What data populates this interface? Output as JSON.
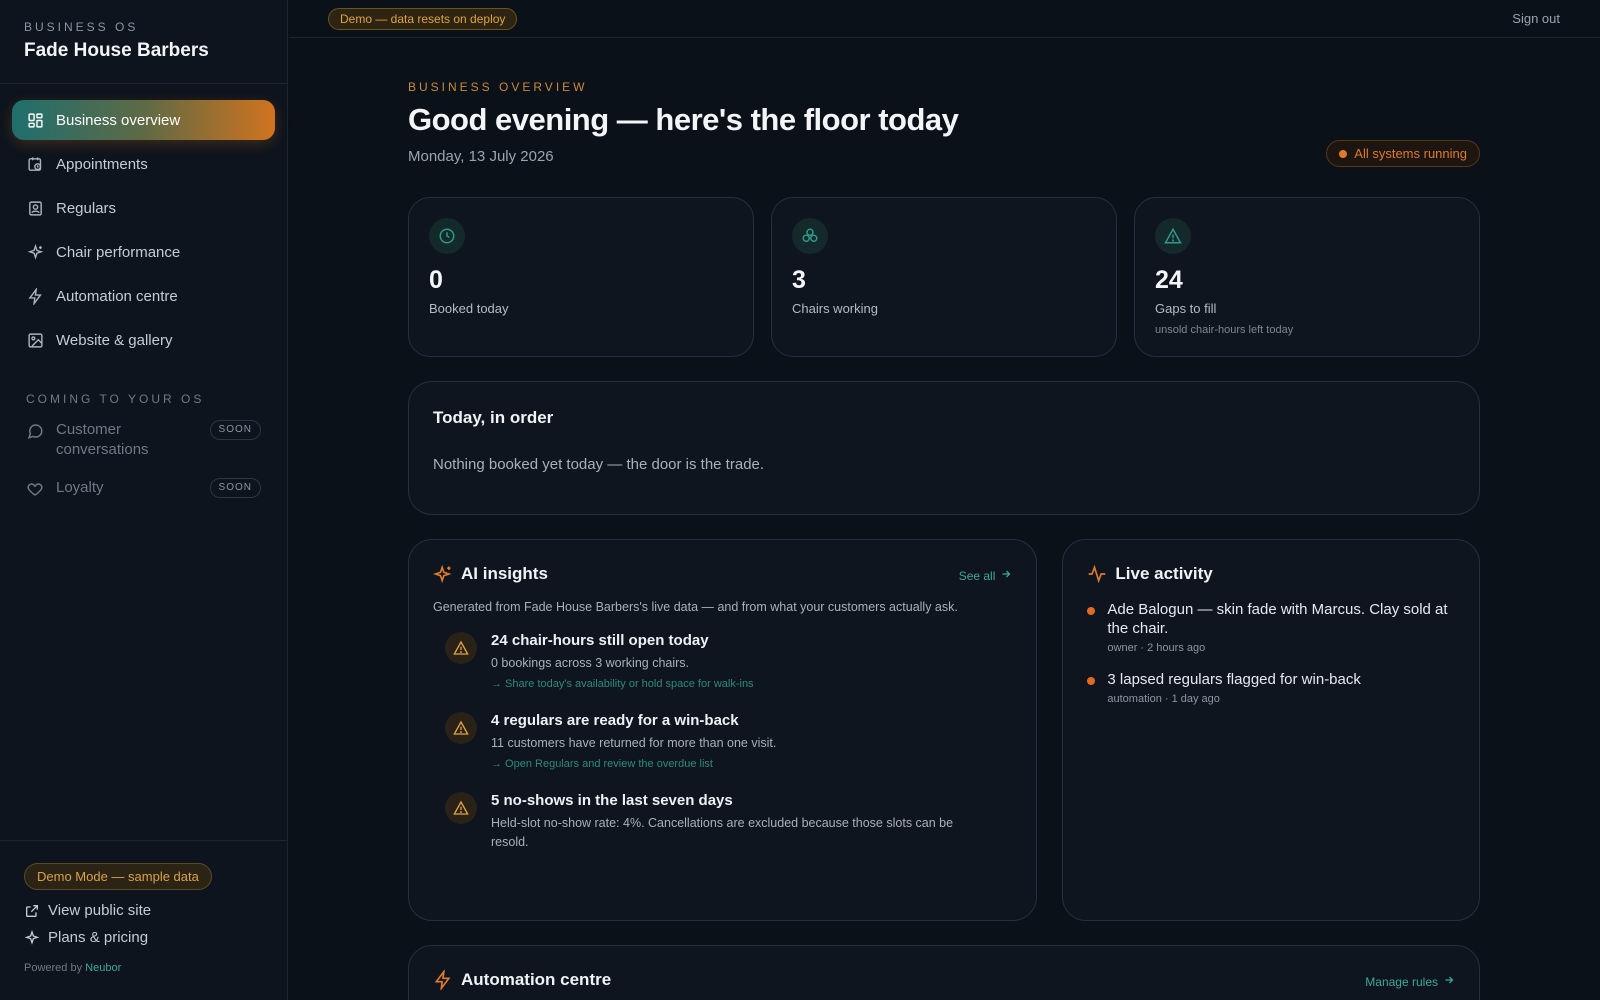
{
  "brand": {
    "eyebrow": "BUSINESS OS",
    "name": "Fade House Barbers"
  },
  "nav": {
    "items": [
      {
        "label": "Business overview",
        "icon": "grid-icon",
        "active": true
      },
      {
        "label": "Appointments",
        "icon": "calendar-clock-icon"
      },
      {
        "label": "Regulars",
        "icon": "contact-badge-icon"
      },
      {
        "label": "Chair performance",
        "icon": "sparkle-icon"
      },
      {
        "label": "Automation centre",
        "icon": "lightning-icon"
      },
      {
        "label": "Website & gallery",
        "icon": "image-icon"
      }
    ],
    "coming_label": "COMING TO YOUR OS",
    "coming": [
      {
        "label": "Customer conversations",
        "badge": "SOON",
        "icon": "chat-icon"
      },
      {
        "label": "Loyalty",
        "badge": "SOON",
        "icon": "heart-icon"
      }
    ]
  },
  "sidebar_footer": {
    "demo_mode": "Demo Mode — sample data",
    "view_public_site": "View public site",
    "plans_pricing": "Plans & pricing",
    "powered_prefix": "Powered by",
    "powered_brand": "Neubor"
  },
  "topbar": {
    "demo_banner": "Demo — data resets on deploy",
    "sign_out": "Sign out"
  },
  "header": {
    "eyebrow": "BUSINESS OVERVIEW",
    "title": "Good evening — here's the floor today",
    "date": "Monday, 13 July 2026",
    "status": "All systems running"
  },
  "stats": [
    {
      "value": "0",
      "label": "Booked today",
      "sub": "",
      "icon": "clock-icon"
    },
    {
      "value": "3",
      "label": "Chairs working",
      "sub": "",
      "icon": "chairs-icon"
    },
    {
      "value": "24",
      "label": "Gaps to fill",
      "sub": "unsold chair-hours left today",
      "icon": "warning-icon"
    }
  ],
  "today": {
    "title": "Today, in order",
    "empty": "Nothing booked yet today — the door is the trade."
  },
  "ai": {
    "title": "AI insights",
    "see_all": "See all",
    "subtitle": "Generated from Fade House Barbers's live data — and from what your customers actually ask.",
    "insights": [
      {
        "title": "24 chair-hours still open today",
        "desc": "0 bookings across 3 working chairs.",
        "action": "→ Share today's availability or hold space for walk-ins"
      },
      {
        "title": "4 regulars are ready for a win-back",
        "desc": "11 customers have returned for more than one visit.",
        "action": "→ Open Regulars and review the overdue list"
      },
      {
        "title": "5 no-shows in the last seven days",
        "desc": "Held-slot no-show rate: 4%. Cancellations are excluded because those slots can be resold.",
        "action": ""
      }
    ]
  },
  "live": {
    "title": "Live activity",
    "items": [
      {
        "text": "Ade Balogun — skin fade with Marcus. Clay sold at the chair.",
        "meta": "owner · 2 hours ago"
      },
      {
        "text": "3 lapsed regulars flagged for win-back",
        "meta": "automation · 1 day ago"
      }
    ]
  },
  "automation": {
    "title": "Automation centre",
    "manage": "Manage rules"
  },
  "colors": {
    "accent_teal": "#3fa89a",
    "accent_orange": "#e07a2c",
    "warning_amber": "#e0a347"
  }
}
